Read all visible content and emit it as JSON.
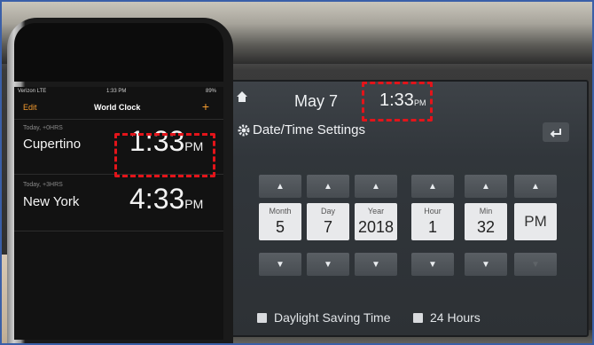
{
  "car_display": {
    "date": "May  7",
    "time": "1:33",
    "time_ampm": "PM",
    "section_title": "Date/Time Settings",
    "fields": [
      {
        "label": "Month",
        "value": "5"
      },
      {
        "label": "Day",
        "value": "7"
      },
      {
        "label": "Year",
        "value": "2018"
      },
      {
        "label": "Hour",
        "value": "1"
      },
      {
        "label": "Min",
        "value": "32"
      }
    ],
    "ampm_value": "PM",
    "up_arrow": "▲",
    "down_arrow": "▼",
    "checkbox_daylight_label": "Daylight Saving Time",
    "checkbox_24h_label": "24 Hours",
    "back_icon": "back-arrow-icon",
    "home_icon": "home-icon",
    "gear_icon": "gear-icon"
  },
  "phone": {
    "status_carrier": "Verizon  LTE",
    "status_time": "1:33 PM",
    "status_battery": "89%",
    "nav_edit": "Edit",
    "nav_title": "World Clock",
    "nav_plus": "+",
    "clocks": [
      {
        "sub": "Today, +0HRS",
        "city": "Cupertino",
        "time": "1:33",
        "ampm": "PM"
      },
      {
        "sub": "Today, +3HRS",
        "city": "New York",
        "time": "4:33",
        "ampm": "PM"
      }
    ]
  },
  "colors": {
    "highlight": "#e3141a",
    "ios_accent": "#f29a2e",
    "border": "#3a5fa8"
  }
}
